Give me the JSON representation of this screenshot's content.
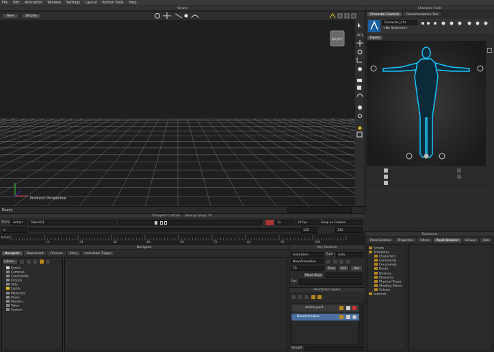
{
  "menu": [
    "File",
    "Edit",
    "Animation",
    "Window",
    "Settings",
    "Layout",
    "Python Tools",
    "Help"
  ],
  "viewer": {
    "title": "Viewer",
    "new_label": "New",
    "display_label": "Display",
    "camera_label": "Producer Perspective",
    "status": "Ready",
    "cube_label": "RIGHT"
  },
  "character_tools": {
    "title": "Character Tools",
    "tabs": [
      "Character Controls",
      "Characterization Tool"
    ],
    "character_field": "Character_Ctrl",
    "selection": "<No Selection>",
    "figure_tab": "Figure"
  },
  "transport": {
    "title": "Transport Controls",
    "keying_group": "Keying Group: TR",
    "story_label": "Story",
    "action_label": "Action",
    "take": "Take 001",
    "speed": "1x",
    "fps": "24 fps",
    "snap": "Snap on Frames",
    "start_frame": "0",
    "end_frame": "120",
    "end_frame2": "120",
    "timeline_label": "Action",
    "ticks": [
      "12",
      "24",
      "36",
      "48",
      "60",
      "72",
      "84",
      "96",
      "108"
    ]
  },
  "navigator": {
    "title": "Navigator",
    "tabs": [
      "Navigator",
      "Dopesheet",
      "FCurves",
      "Story",
      "Animation Trigger"
    ],
    "filters_label": "Filters...",
    "tree": [
      "Scene",
      "Cameras",
      "Constraints",
      "Groups",
      "Sets",
      "Lights",
      "Materials",
      "Poses",
      "Shaders",
      "Takes",
      "System"
    ]
  },
  "key_controls": {
    "title": "Key Controls",
    "animation_label": "Animation",
    "type_label": "Type :",
    "type_value": "Auto",
    "base_animation": "BaseAnimation",
    "tr_label": "TR",
    "zero_label": "Zero",
    "pvt_label": "Pvt",
    "rel_label": "Rel",
    "move_keys_label": "Move Keys",
    "ref_label": "Ref."
  },
  "animation_layers": {
    "title": "Animation Layers",
    "layers": [
      "AnimLayer1",
      "BaseAnimation"
    ],
    "weight_label": "Weight"
  },
  "resources": {
    "title": "Resources",
    "tabs": [
      "Pose Controls",
      "Properties",
      "Filters",
      "Asset Browser",
      "Groups",
      "Sets"
    ],
    "tree": [
      "Scripts",
      "Templates",
      "Characters",
      "Commands",
      "Constraints",
      "Decks",
      "Devices",
      "Elements",
      "Physical Prope",
      "Shading Eleme",
      "Solvers",
      "tutorials"
    ]
  },
  "colors": {
    "figure_glow": "#17c7ff",
    "viewport_bg": "#1f1f1f",
    "grid": "#7a7a7a",
    "layer_selected": "#4a6fa0",
    "accent_orange": "#c96a1b"
  }
}
